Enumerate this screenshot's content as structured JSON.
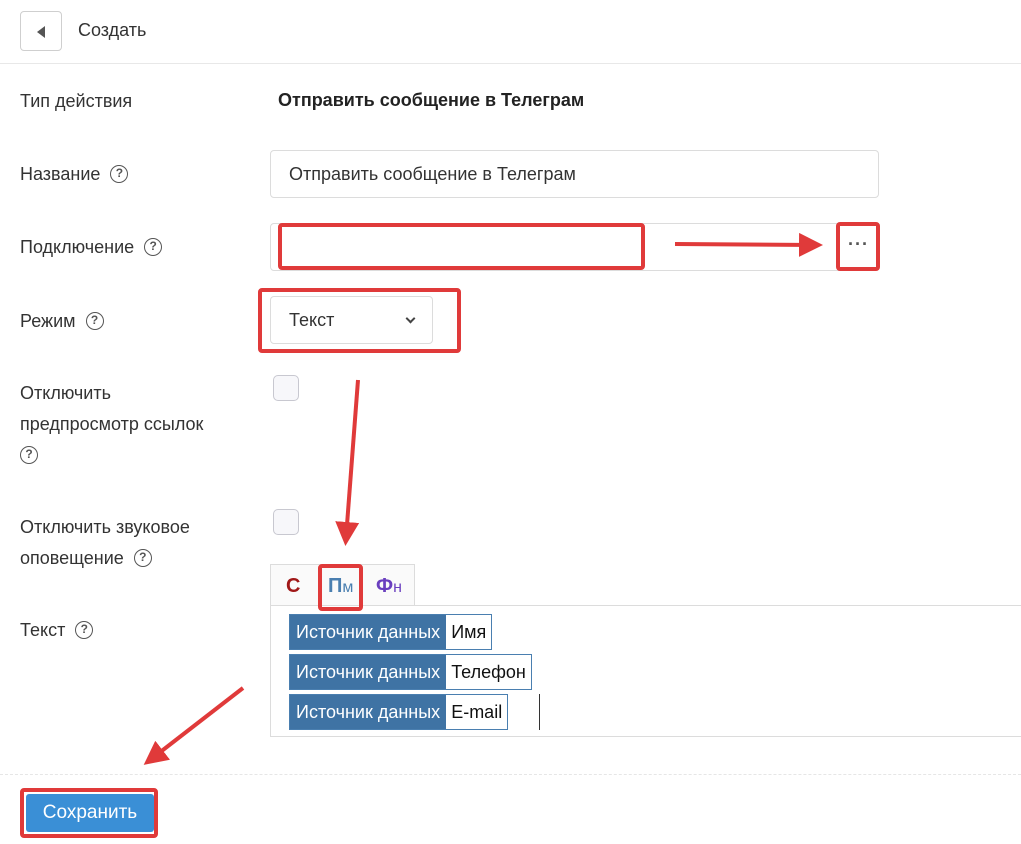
{
  "header": {
    "title": "Создать"
  },
  "form": {
    "action_type": {
      "label": "Тип действия",
      "value": "Отправить сообщение в Телеграм"
    },
    "name": {
      "label": "Название",
      "help": "?",
      "value": "Отправить сообщение в Телеграм"
    },
    "connection": {
      "label": "Подключение",
      "help": "?",
      "value": "",
      "button_label": "···"
    },
    "mode": {
      "label": "Режим",
      "help": "?",
      "selected": "Текст"
    },
    "disable_preview": {
      "label_line1": "Отключить",
      "label_line2": "предпросмотр ссылок",
      "help": "?",
      "checked": false
    },
    "disable_sound": {
      "label_line1": "Отключить звуковое",
      "label_line2": "оповещение",
      "help": "?",
      "checked": false
    },
    "text": {
      "label": "Текст",
      "help": "?",
      "tabs": [
        {
          "main": "С",
          "sub": ""
        },
        {
          "main": "П",
          "sub": "м"
        },
        {
          "main": "Ф",
          "sub": "н"
        }
      ],
      "tokens": [
        {
          "source": "Источник данных",
          "field": "Имя"
        },
        {
          "source": "Источник данных",
          "field": "Телефон"
        },
        {
          "source": "Источник данных",
          "field": "E-mail"
        }
      ]
    }
  },
  "footer": {
    "save_label": "Сохранить"
  },
  "colors": {
    "accent": "#3a8fd6",
    "token_bg": "#3f73a4",
    "annotation": "#e03a3a"
  }
}
